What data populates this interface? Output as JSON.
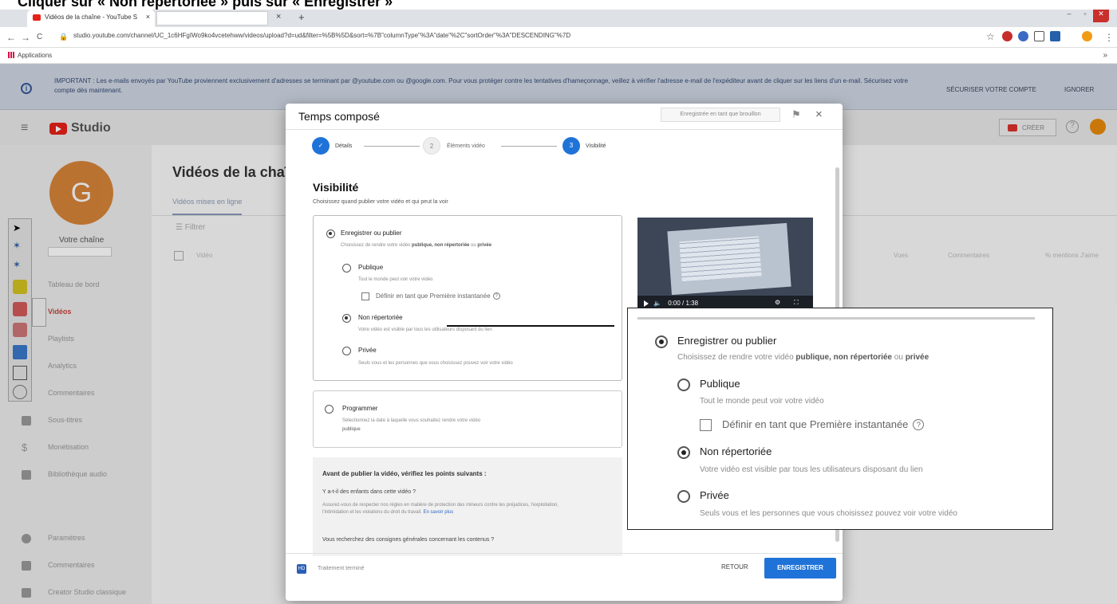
{
  "caption": "Cliquer sur « Non répertoriée » puis sur « Enregistrer »",
  "browser": {
    "tab_title": "Vidéos de la chaîne - YouTube S",
    "tab_close": "×",
    "second_tab_close": "×",
    "new_tab": "+",
    "url": "studio.youtube.com/channel/UC_1c6HFgIWo9ko4vcetehww/videos/upload?d=ud&filter=%5B%5D&sort=%7B\"columnType\"%3A\"date\"%2C\"sortOrder\"%3A\"DESCENDING\"%7D",
    "bookmarks_label": "Applications",
    "nav_back": "←",
    "nav_forward": "→",
    "nav_reload": "C",
    "star": "☆",
    "more": "⋮"
  },
  "banner": {
    "info": "i",
    "text": "IMPORTANT : Les e-mails envoyés par YouTube proviennent exclusivement d'adresses se terminant par @youtube.com ou @google.com. Pour vous protéger contre les tentatives d'hameçonnage, veillez à vérifier l'adresse e-mail de l'expéditeur avant de cliquer sur les liens d'un e-mail. Sécurisez votre compte dès maintenant.",
    "secure": "SÉCURISER VOTRE COMPTE",
    "ignore": "IGNORER"
  },
  "studio": {
    "logo_text": "Studio",
    "create": "CRÉER",
    "help": "?"
  },
  "sidebar": {
    "avatar_letter": "G",
    "channel": "Votre chaîne",
    "items": [
      {
        "label": "Tableau de bord"
      },
      {
        "label": "Vidéos"
      },
      {
        "label": "Playlists"
      },
      {
        "label": "Analytics"
      },
      {
        "label": "Commentaires"
      },
      {
        "label": "Sous-titres"
      },
      {
        "label": "Monétisation"
      },
      {
        "label": "Bibliothèque audio"
      },
      {
        "label": "Paramètres"
      },
      {
        "label": "Commentaires"
      },
      {
        "label": "Creator Studio classique"
      }
    ]
  },
  "main": {
    "title": "Vidéos de la chaîne",
    "tab": "Vidéos mises en ligne",
    "filter": "Filtrer",
    "col_video": "Vidéo",
    "col_views": "Vues",
    "col_comments": "Commentaires",
    "col_likes": "% mentions J'aime"
  },
  "modal": {
    "title": "Temps composé",
    "draft": "Enregistrée en tant que brouillon",
    "close": "×",
    "steps": [
      {
        "num": "✓",
        "label": "Détails"
      },
      {
        "num": "2",
        "label": "Éléments vidéo"
      },
      {
        "num": "3",
        "label": "Visibilité"
      }
    ],
    "visibility_title": "Visibilité",
    "visibility_sub": "Choisissez quand publier votre vidéo et qui peut la voir",
    "save_or_publish": "Enregistrer ou publier",
    "save_or_publish_hint_a": "Choisissez de rendre votre vidéo ",
    "save_or_publish_hint_b": "publique, non répertoriée",
    "save_or_publish_hint_c": " ou ",
    "save_or_publish_hint_d": "privée",
    "public": "Publique",
    "public_hint": "Tout le monde peut voir votre vidéo",
    "premiere": "Définir en tant que Première instantanée",
    "qmark": "?",
    "unlisted": "Non répertoriée",
    "unlisted_hint": "Votre vidéo est visible par tous les utilisateurs disposant du lien",
    "private": "Privée",
    "private_hint": "Seuls vous et les personnes que vous choisissez pouvez voir votre vidéo",
    "schedule": "Programmer",
    "schedule_hint_1": "Sélectionnez la date à laquelle vous souhaitez rendre votre vidéo",
    "schedule_hint_2": "publique",
    "check_title": "Avant de publier la vidéo, vérifiez les points suivants :",
    "check_q": "Y a-t-il des enfants dans cette vidéo ?",
    "check_text": "Assurez-vous de respecter nos règles en matière de protection des mineurs contre les préjudices, l'exploitation, l'intimidation et les violations du droit du travail.",
    "learn_more": "En savoir plus",
    "check_q2": "Vous recherchez des consignes générales concernant les contenus ?",
    "video_time": "0:00 / 1:38",
    "processing": "Traitement terminé",
    "processing_icon": "HD",
    "back": "RETOUR",
    "save": "ENREGISTRER"
  }
}
